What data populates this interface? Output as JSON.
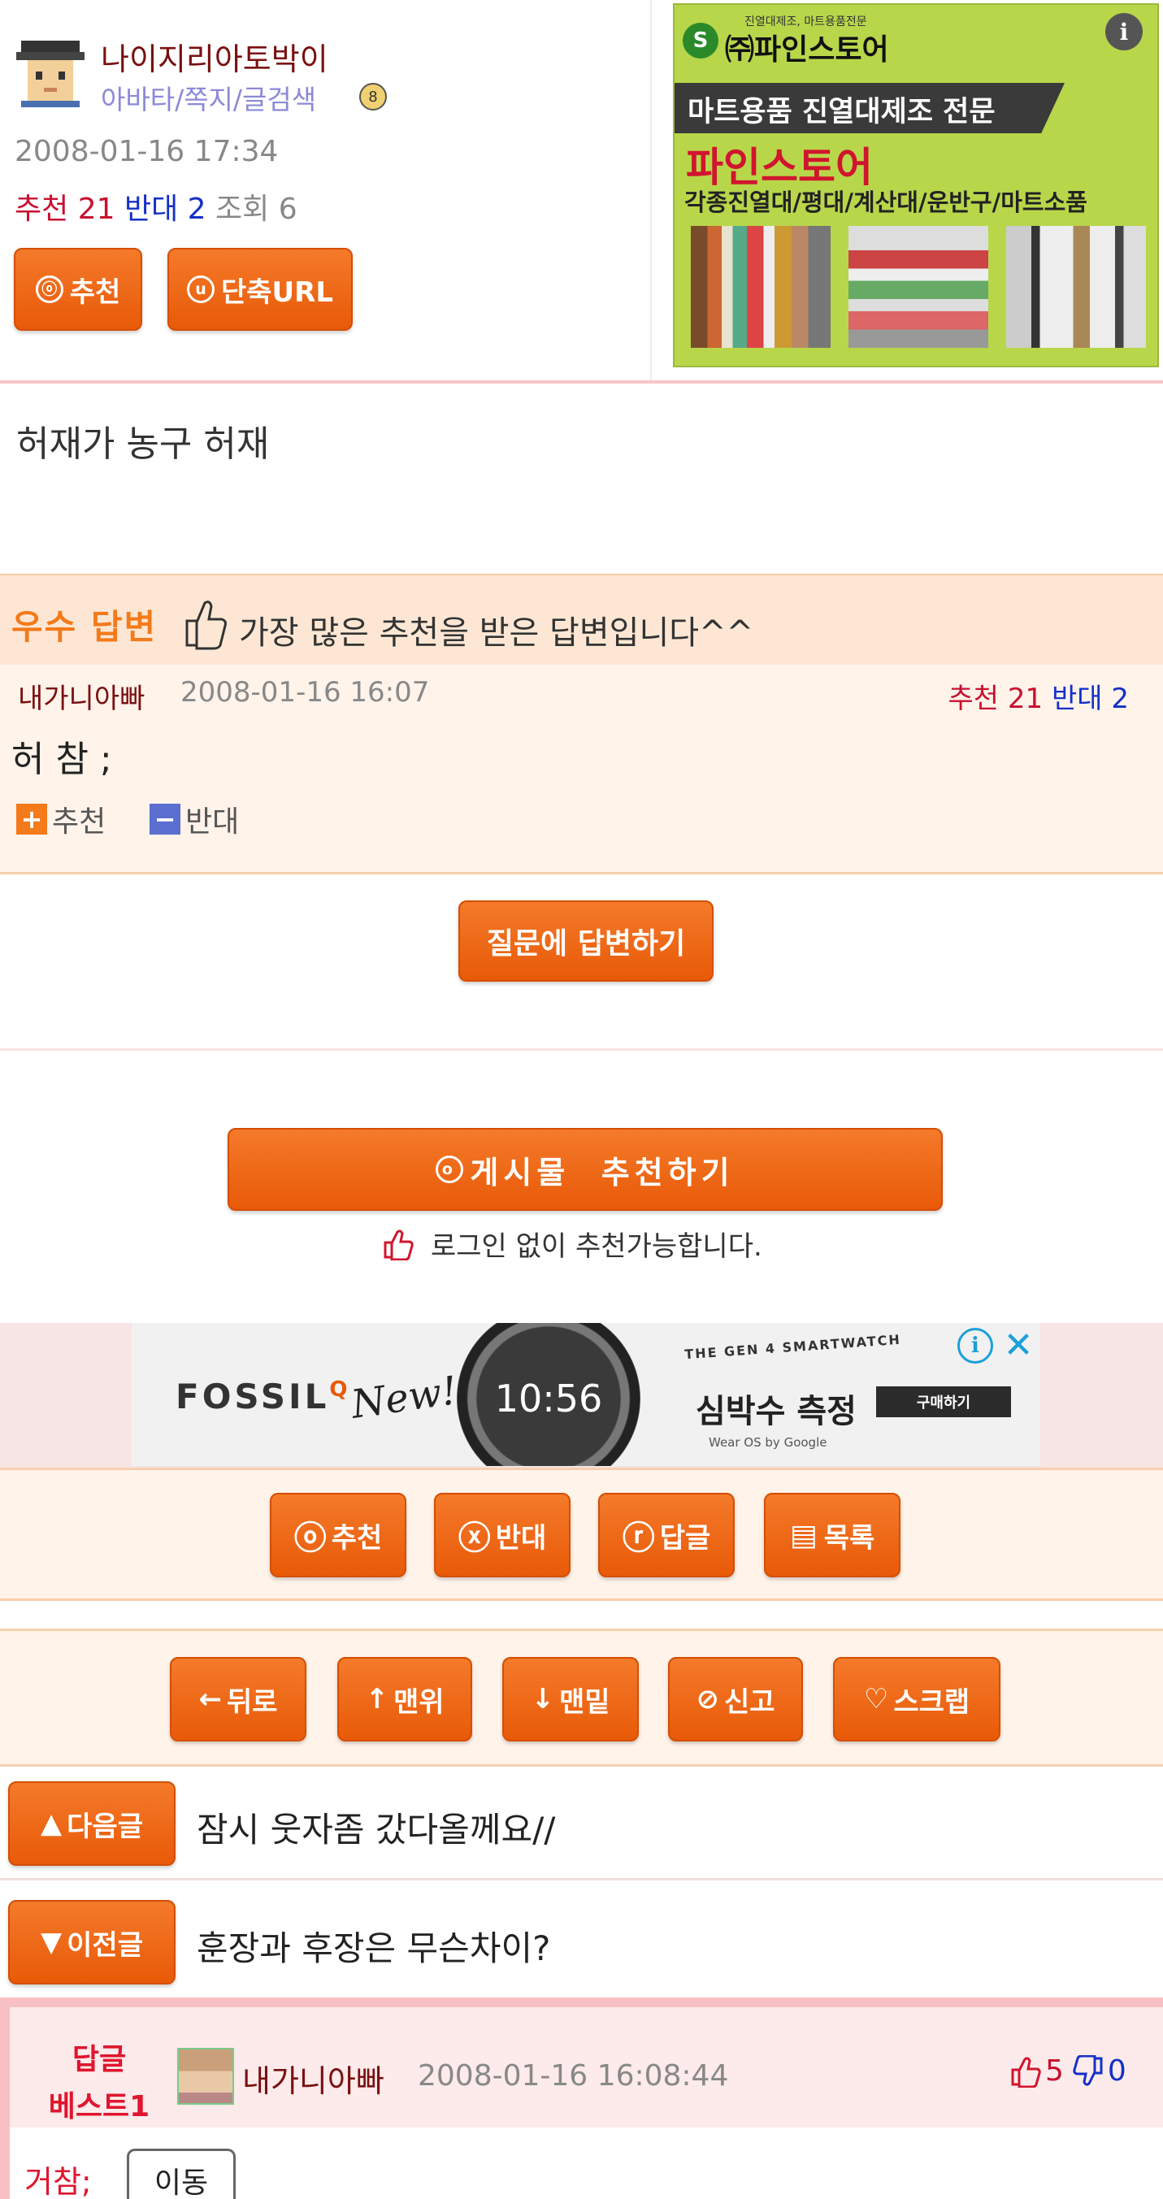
{
  "author": {
    "nickname": "나이지리아토박이",
    "links": "아바타/쪽지/글검색",
    "datetime": "2008-01-16 17:34",
    "rec_label": "추천",
    "rec_count": "21",
    "opp_label": "반대",
    "opp_count": "2",
    "view_label": "조회",
    "view_count": "6"
  },
  "top_buttons": {
    "recommend_icon": "ⓞ",
    "recommend": "추천",
    "shorturl_icon": "u",
    "shorturl": "단축URL"
  },
  "ad1": {
    "small_text": "진열대제조, 마트용품전문",
    "brand": "㈜파인스토어",
    "banner": "마트용품 진열대제조 전문",
    "title": "파인스토어",
    "subtitle": "각종진열대/평대/계산대/운반구/마트소품",
    "info": "i"
  },
  "post": {
    "body": "허재가 농구 허재"
  },
  "best_answer": {
    "tag": "우수 답변",
    "desc": "가장 많은 추천을 받은 답변입니다^^",
    "author": "내가니아빠",
    "datetime": "2008-01-16 16:07",
    "rec_label": "추천",
    "rec_count": "21",
    "opp_label": "반대",
    "opp_count": "2",
    "body": "허 참 ;",
    "plus": "+",
    "rec_btn": "추천",
    "minus": "−",
    "opp_btn": "반대"
  },
  "answer_button": "질문에 답변하기",
  "recommend_post": {
    "label": "게시물  추천하기",
    "note": "로그인 없이 추천가능합니다."
  },
  "ad2": {
    "brand": "FOSSIL",
    "brand_q": "Q",
    "new": "New!",
    "time": "10:56",
    "tagline": "THE GEN 4 SMARTWATCH",
    "headline": "심박수 측정",
    "buy": "구매하기",
    "powered": "Wear OS by Google"
  },
  "action_row1": [
    {
      "icon": "ⓞ",
      "label": "추천"
    },
    {
      "icon": "ⓧ",
      "label": "반대"
    },
    {
      "icon": "ⓡ",
      "label": "답글"
    },
    {
      "icon": "▤",
      "label": "목록"
    }
  ],
  "action_row2": [
    {
      "icon": "←",
      "label": "뒤로"
    },
    {
      "icon": "↑",
      "label": "맨위"
    },
    {
      "icon": "↓",
      "label": "맨밑"
    },
    {
      "icon": "⊘",
      "label": "신고"
    },
    {
      "icon": "♡",
      "label": "스크랩"
    }
  ],
  "nav": {
    "next_label": "다음글",
    "next_title": "잠시 웃자좀 갔다올께요//",
    "prev_label": "이전글",
    "prev_title": "훈장과 후장은 무슨차이?"
  },
  "best_reply": {
    "tag_line1": "답글",
    "tag_line2": "베스트1",
    "author": "내가니아빠",
    "datetime": "2008-01-16 16:08:44",
    "up": "5",
    "down": "0",
    "body": "거참;",
    "move": "이동"
  },
  "colors": {
    "accent": "#e85a08",
    "rec_red": "#c8102e",
    "opp_blue": "#1530c8"
  }
}
